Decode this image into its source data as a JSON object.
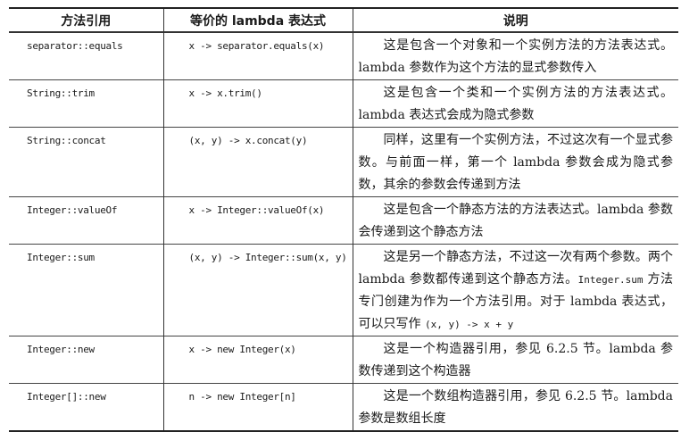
{
  "table": {
    "headers": [
      "方法引用",
      "等价的 lambda 表达式",
      "说明"
    ],
    "rows": [
      {
        "ref": "separator::equals",
        "lambda": "x -> separator.equals(x)",
        "desc": "这是包含一个对象和一个实例方法的方法表达式。lambda 参数作为这个方法的显式参数传入"
      },
      {
        "ref": "String::trim",
        "lambda": "x -> x.trim()",
        "desc": "这是包含一个类和一个实例方法的方法表达式。lambda 表达式会成为隐式参数"
      },
      {
        "ref": "String::concat",
        "lambda": "(x, y) -> x.concat(y)",
        "desc": "同样，这里有一个实例方法，不过这次有一个显式参数。与前面一样，第一个 lambda 参数会成为隐式参数，其余的参数会传递到方法"
      },
      {
        "ref": "Integer::valueOf",
        "lambda": "x -> Integer::valueOf(x)",
        "desc": "这是包含一个静态方法的方法表达式。lambda 参数会传递到这个静态方法"
      },
      {
        "ref": "Integer::sum",
        "lambda": "(x, y) -> Integer::sum(x, y)",
        "desc_a": "这是另一个静态方法，不过这一次有两个参数。两个 lambda 参数都传递到这个静态方法。",
        "desc_code": "Integer.sum",
        "desc_b": " 方法专门创建为作为一个方法引用。对于 lambda 表达式，可以只写作 ",
        "desc_code2": "(x, y) -> x + y"
      },
      {
        "ref": "Integer::new",
        "lambda": "x -> new Integer(x)",
        "desc": "这是一个构造器引用，参见 6.2.5 节。lambda 参数传递到这个构造器"
      },
      {
        "ref": "Integer[]::new",
        "lambda": "n -> new Integer[n]",
        "desc": "这是一个数组构造器引用，参见 6.2.5 节。lambda 参数是数组长度"
      }
    ]
  }
}
